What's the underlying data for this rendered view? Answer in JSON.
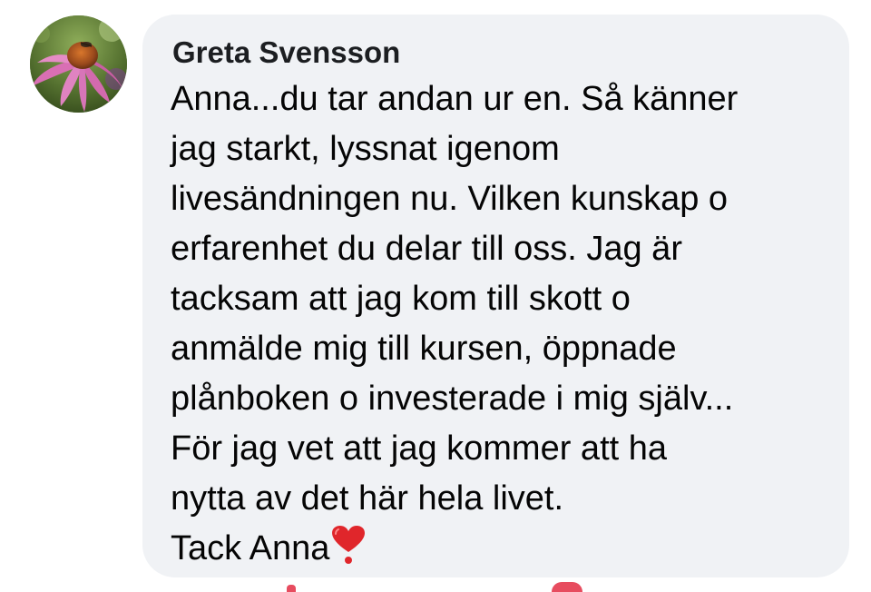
{
  "comment": {
    "author": "Greta Svensson",
    "lines": [
      "Anna...du tar andan ur en. Så känner",
      "jag starkt, lyssnat igenom",
      "livesändningen nu. Vilken kunskap o",
      "erfarenhet du delar till oss. Jag är",
      "tacksam att jag kom till skott o",
      "anmälde mig till kursen, öppnade",
      "plånboken o investerade i mig själv...",
      "För jag vet att jag kommer att ha",
      "nytta av det här hela livet."
    ],
    "closing": "Tack Anna",
    "closing_emoji": "heart-exclamation-icon",
    "avatar_image": "pink-coneflower-photo"
  },
  "colors": {
    "bubble_background": "#f0f2f5",
    "author_text": "#1c1e21",
    "body_text": "#050505",
    "heart": "#e0262b",
    "reaction_accent": "#e74c5f"
  }
}
